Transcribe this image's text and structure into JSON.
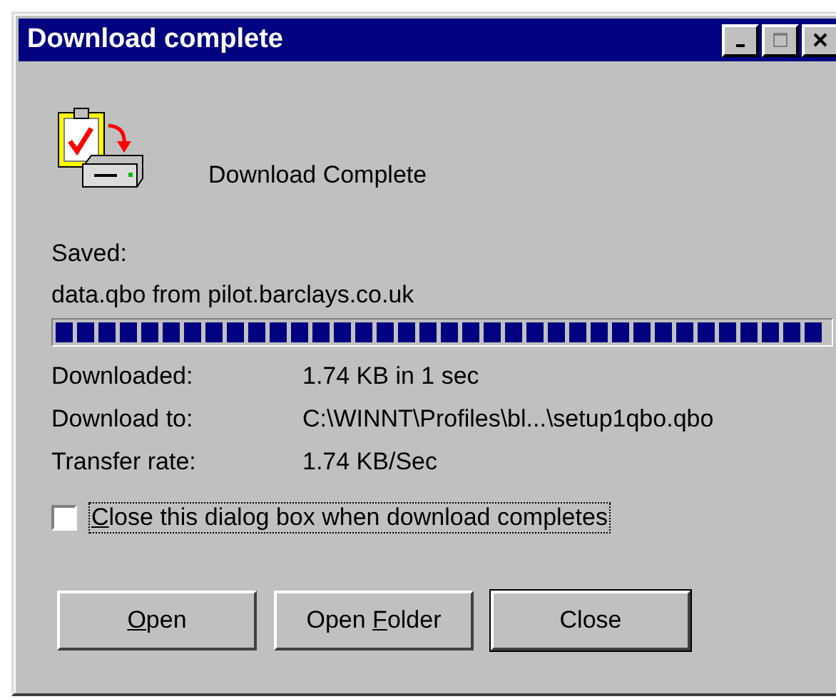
{
  "window": {
    "title": "Download complete",
    "controls": [
      {
        "kind": "minimize"
      },
      {
        "kind": "maximize"
      },
      {
        "kind": "close"
      }
    ]
  },
  "heading": "Download Complete",
  "saved_label": "Saved:",
  "saved_file": "data.qbo from pilot.barclays.co.uk",
  "progress": {
    "level": 1
  },
  "details": [
    {
      "label": "Downloaded:",
      "value": "1.74 KB in 1 sec"
    },
    {
      "label": "Download to:",
      "value": "C:\\WINNT\\Profiles\\bl...\\setup1qbo.qbo"
    },
    {
      "label": "Transfer rate:",
      "value": "1.74 KB/Sec"
    }
  ],
  "close_when_done": {
    "label": {
      "accel": "C",
      "after": "lose this dialog box when download completes"
    },
    "checked": false,
    "focused": true
  },
  "buttons": [
    {
      "label": {
        "accel": "O",
        "after": "pen"
      },
      "default": false
    },
    {
      "label": {
        "before": "Open ",
        "accel": "F",
        "after": "older"
      },
      "default": false
    },
    {
      "label": {
        "before": "Close"
      },
      "default": true
    }
  ]
}
